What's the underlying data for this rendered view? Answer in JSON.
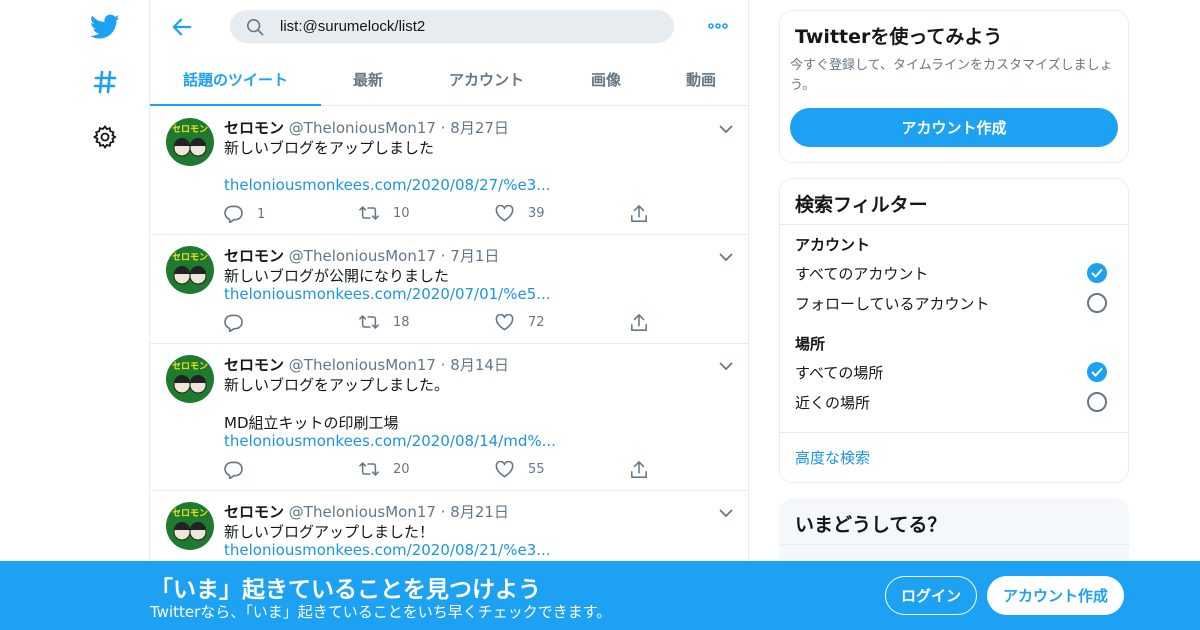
{
  "nav": {
    "items": [
      {
        "icon": "twitter-bird-icon",
        "color": "#1da1f2"
      },
      {
        "icon": "hashtag-explore-icon",
        "color": "#1da1f2"
      },
      {
        "icon": "gear-icon",
        "color": "#14171a"
      }
    ]
  },
  "search": {
    "value": "list:@surumelock/list2"
  },
  "tabs": [
    {
      "label": "話題のツイート",
      "active": true
    },
    {
      "label": "最新",
      "active": false
    },
    {
      "label": "アカウント",
      "active": false
    },
    {
      "label": "画像",
      "active": false
    },
    {
      "label": "動画",
      "active": false
    }
  ],
  "tweets": [
    {
      "name": "セロモン",
      "handle": "@TheloniousMon17",
      "dot": "·",
      "date": "8月27日",
      "text_lines": [
        "新しいブログをアップしました",
        ""
      ],
      "link": "theloniousmonkees.com/2020/08/27/%e3...",
      "replies": "1",
      "retweets": "10",
      "likes": "39"
    },
    {
      "name": "セロモン",
      "handle": "@TheloniousMon17",
      "dot": "·",
      "date": "7月1日",
      "text_lines": [
        "新しいブログが公開になりました"
      ],
      "link": "theloniousmonkees.com/2020/07/01/%e5...",
      "replies": "",
      "retweets": "18",
      "likes": "72"
    },
    {
      "name": "セロモン",
      "handle": "@TheloniousMon17",
      "dot": "·",
      "date": "8月14日",
      "text_lines": [
        "新しいブログをアップしました。",
        "",
        "MD組立キットの印刷工場"
      ],
      "link": "theloniousmonkees.com/2020/08/14/md%...",
      "replies": "",
      "retweets": "20",
      "likes": "55"
    },
    {
      "name": "セロモン",
      "handle": "@TheloniousMon17",
      "dot": "·",
      "date": "8月21日",
      "text_lines": [
        "新しいブログアップしました！"
      ],
      "link": "theloniousmonkees.com/2020/08/21/%e3...",
      "replies": "",
      "retweets": "",
      "likes": ""
    }
  ],
  "avatar_text": "セロモン",
  "signup_card": {
    "title": "Twitterを使ってみよう",
    "desc": "今すぐ登録して、タイムラインをカスタマイズしましょう。",
    "button": "アカウント作成"
  },
  "filter_card": {
    "title": "検索フィルター",
    "account_heading": "アカウント",
    "account_options": [
      {
        "label": "すべてのアカウント",
        "selected": true
      },
      {
        "label": "フォローしているアカウント",
        "selected": false
      }
    ],
    "location_heading": "場所",
    "location_options": [
      {
        "label": "すべての場所",
        "selected": true
      },
      {
        "label": "近くの場所",
        "selected": false
      }
    ],
    "advanced_link": "高度な検索"
  },
  "trends_card": {
    "title": "いまどうしてる？"
  },
  "banner": {
    "title": "「いま」起きていることを見つけよう",
    "subtitle": "Twitterなら、「いま」起きていることをいち早くチェックできます。",
    "login": "ログイン",
    "signup": "アカウント作成"
  },
  "colors": {
    "accent": "#1da1f2",
    "link": "#1b95e0",
    "muted": "#657786",
    "border": "#e6ecf0",
    "avatar_bg": "#1e7a2e",
    "avatar_text": "#f5e21a"
  }
}
